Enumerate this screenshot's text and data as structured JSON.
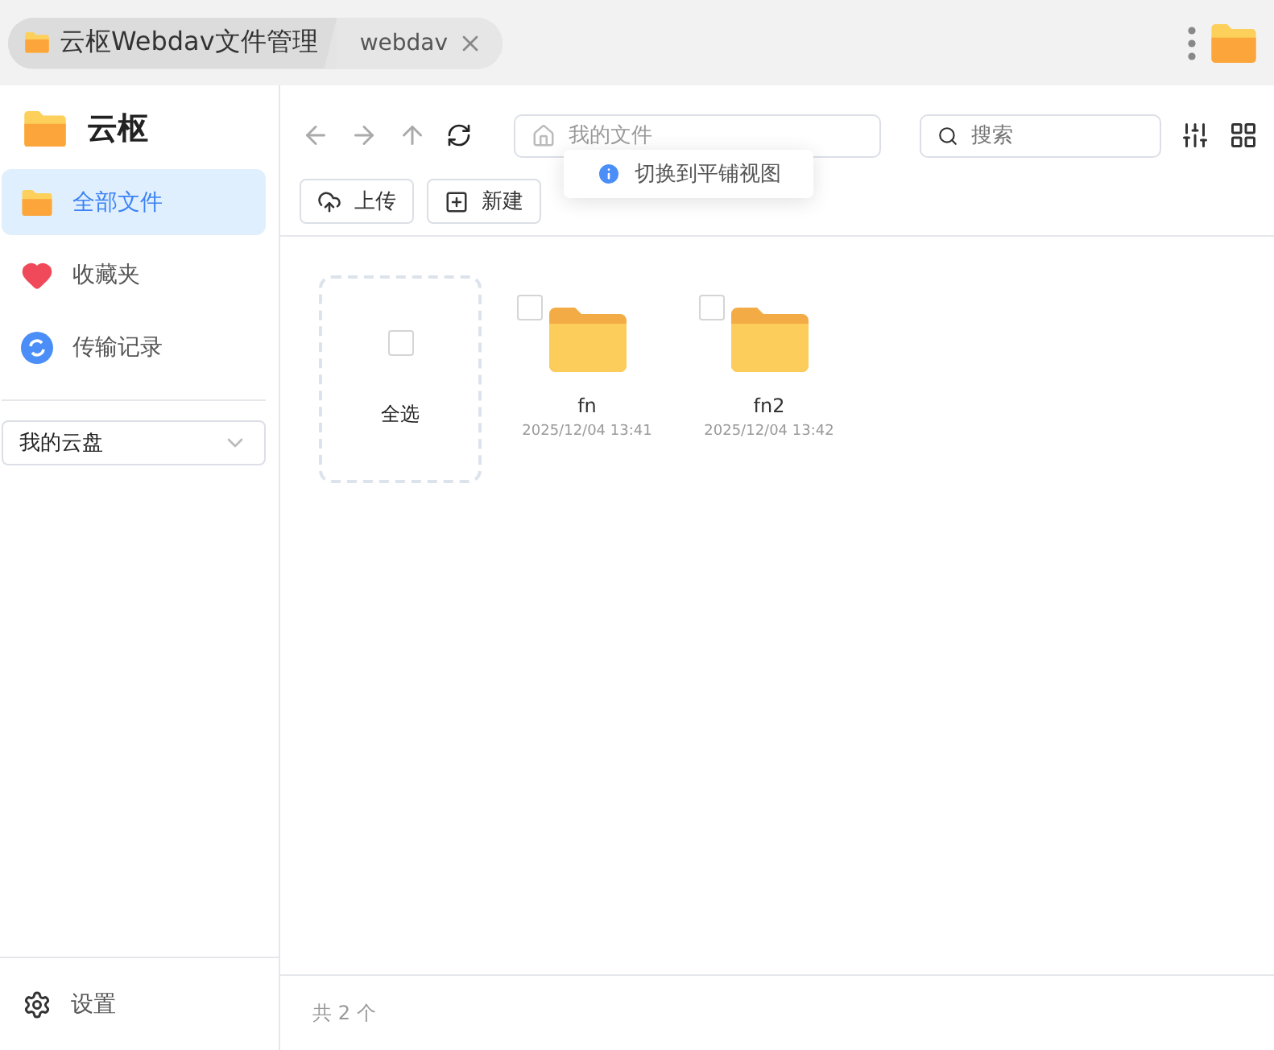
{
  "tabs": [
    {
      "label": "云枢Webdav文件管理",
      "selected": true,
      "closable": false
    },
    {
      "label": "webdav",
      "selected": false,
      "closable": true
    }
  ],
  "sidebar": {
    "title": "云枢",
    "items": [
      {
        "label": "全部文件",
        "kind": "folder",
        "selected": true
      },
      {
        "label": "收藏夹",
        "kind": "heart",
        "selected": false
      },
      {
        "label": "传输记录",
        "kind": "sync",
        "selected": false
      }
    ],
    "drive_select": {
      "value": "我的云盘"
    },
    "settings": "设置"
  },
  "toolbar": {
    "path": "我的文件",
    "tooltip": "切换到平铺视图",
    "search": {
      "placeholder": "搜索"
    },
    "buttons": [
      {
        "label": "上传",
        "kind": "upload"
      },
      {
        "label": "新建",
        "kind": "new"
      }
    ]
  },
  "files": {
    "select_all": {
      "label": "全选",
      "checked": false
    },
    "items": [
      {
        "name": "fn",
        "date": "2025/12/04 13:41",
        "checked": false
      },
      {
        "name": "fn2",
        "date": "2025/12/04 13:42",
        "checked": false
      }
    ]
  },
  "footer": "共 2 个"
}
